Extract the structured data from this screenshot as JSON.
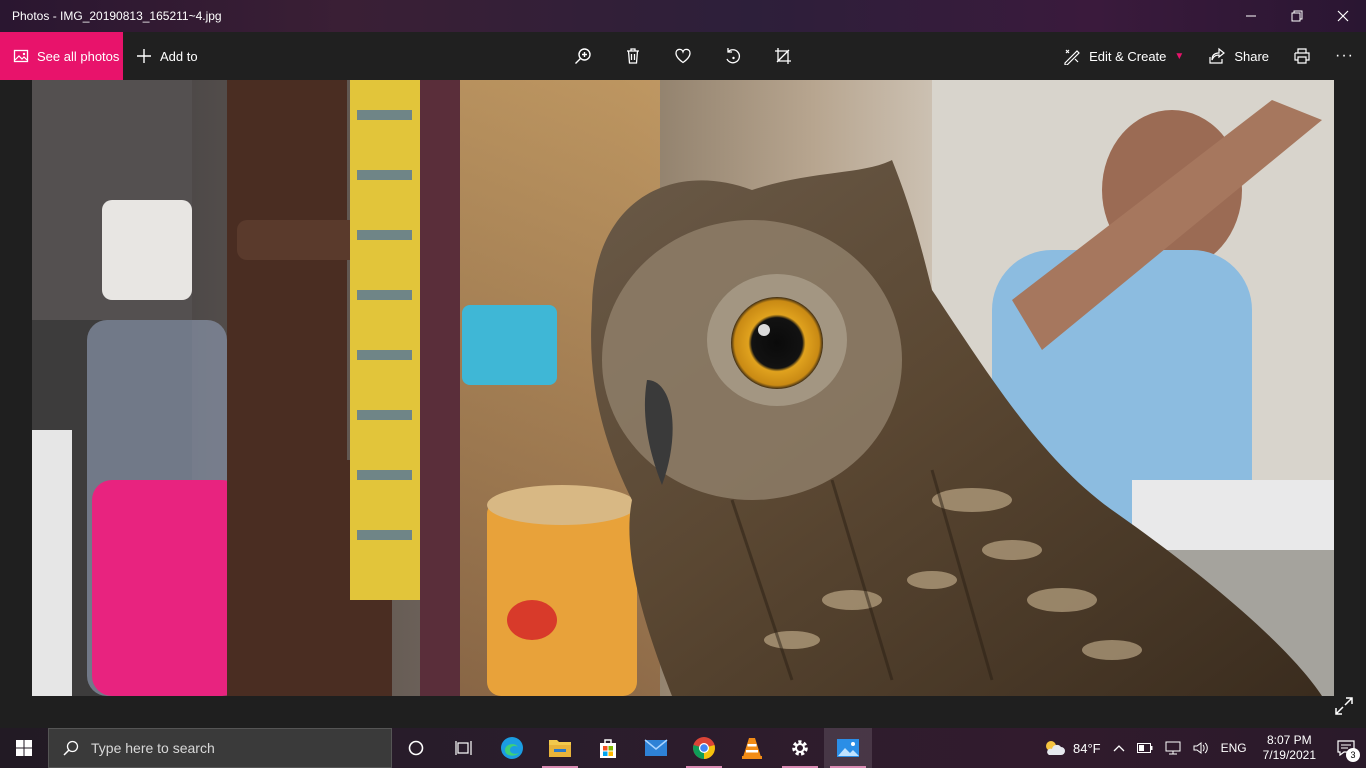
{
  "window": {
    "title": "Photos - IMG_20190813_165211~4.jpg"
  },
  "toolbar": {
    "see_all_label": "See all photos",
    "add_to_label": "Add to",
    "edit_create_label": "Edit & Create",
    "share_label": "Share"
  },
  "photo": {
    "subject": "owl"
  },
  "taskbar": {
    "search_placeholder": "Type here to search",
    "weather_temp": "84°F",
    "language": "ENG",
    "time": "8:07 PM",
    "date": "7/19/2021",
    "notification_count": "3"
  },
  "colors": {
    "accent": "#e8136b",
    "toolbar_bg": "#202020",
    "viewer_bg": "#1f1f1f"
  }
}
